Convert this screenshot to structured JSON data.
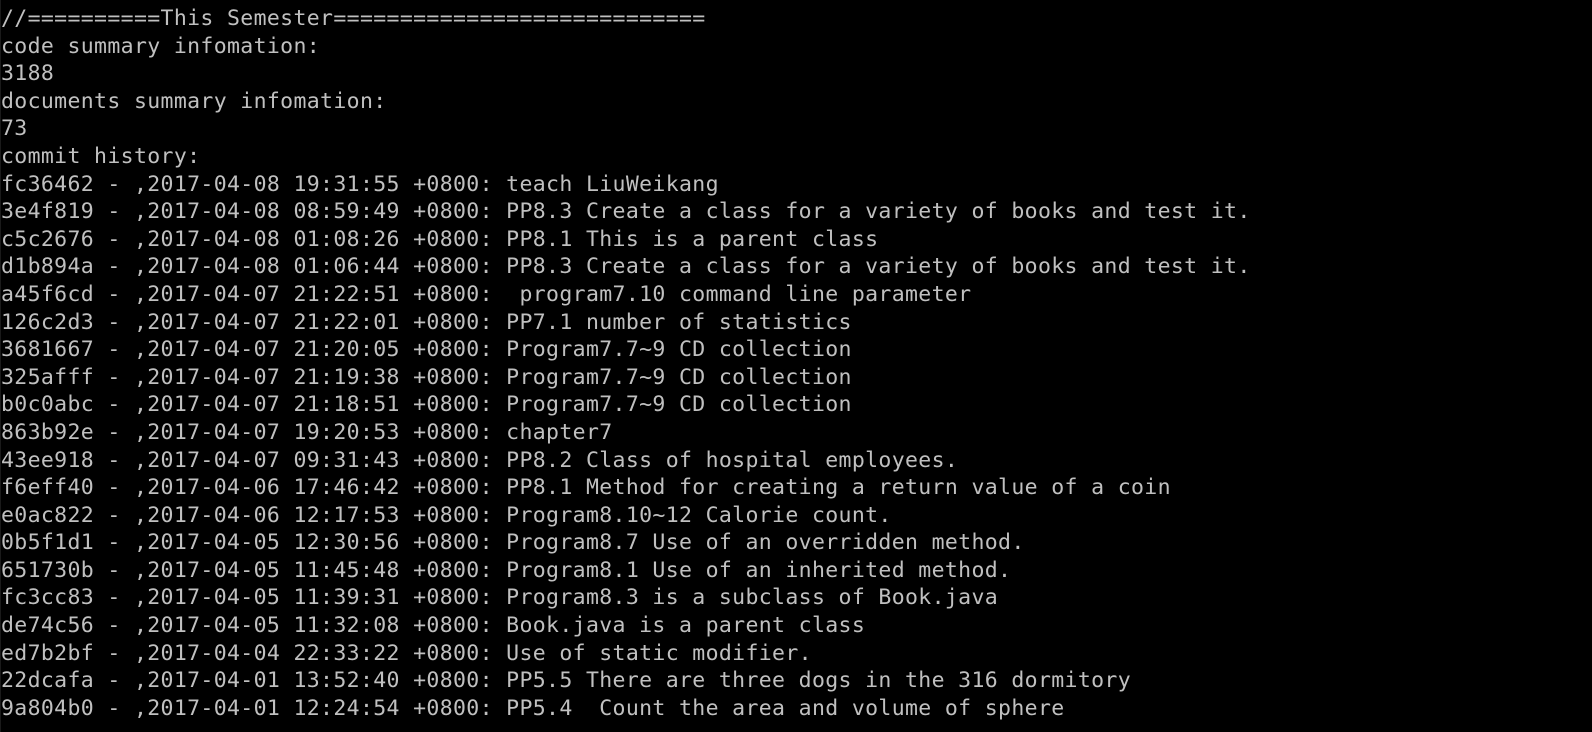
{
  "colors": {
    "background": "#000000",
    "foreground": "#c0c0c0"
  },
  "lines": [
    "//==========This Semester============================",
    "code summary infomation:",
    "3188",
    "documents summary infomation:",
    "73",
    "commit history:",
    "fc36462 - ,2017-04-08 19:31:55 +0800: teach LiuWeikang",
    "3e4f819 - ,2017-04-08 08:59:49 +0800: PP8.3 Create a class for a variety of books and test it.",
    "c5c2676 - ,2017-04-08 01:08:26 +0800: PP8.1 This is a parent class",
    "d1b894a - ,2017-04-08 01:06:44 +0800: PP8.3 Create a class for a variety of books and test it.",
    "a45f6cd - ,2017-04-07 21:22:51 +0800:  program7.10 command line parameter",
    "126c2d3 - ,2017-04-07 21:22:01 +0800: PP7.1 number of statistics",
    "3681667 - ,2017-04-07 21:20:05 +0800: Program7.7~9 CD collection",
    "325afff - ,2017-04-07 21:19:38 +0800: Program7.7~9 CD collection",
    "b0c0abc - ,2017-04-07 21:18:51 +0800: Program7.7~9 CD collection",
    "863b92e - ,2017-04-07 19:20:53 +0800: chapter7",
    "43ee918 - ,2017-04-07 09:31:43 +0800: PP8.2 Class of hospital employees.",
    "f6eff40 - ,2017-04-06 17:46:42 +0800: PP8.1 Method for creating a return value of a coin",
    "e0ac822 - ,2017-04-06 12:17:53 +0800: Program8.10~12 Calorie count.",
    "0b5f1d1 - ,2017-04-05 12:30:56 +0800: Program8.7 Use of an overridden method.",
    "651730b - ,2017-04-05 11:45:48 +0800: Program8.1 Use of an inherited method.",
    "fc3cc83 - ,2017-04-05 11:39:31 +0800: Program8.3 is a subclass of Book.java",
    "de74c56 - ,2017-04-05 11:32:08 +0800: Book.java is a parent class",
    "ed7b2bf - ,2017-04-04 22:33:22 +0800: Use of static modifier.",
    "22dcafa - ,2017-04-01 13:52:40 +0800: PP5.5 There are three dogs in the 316 dormitory",
    "9a804b0 - ,2017-04-01 12:24:54 +0800: PP5.4  Count the area and volume of sphere"
  ]
}
